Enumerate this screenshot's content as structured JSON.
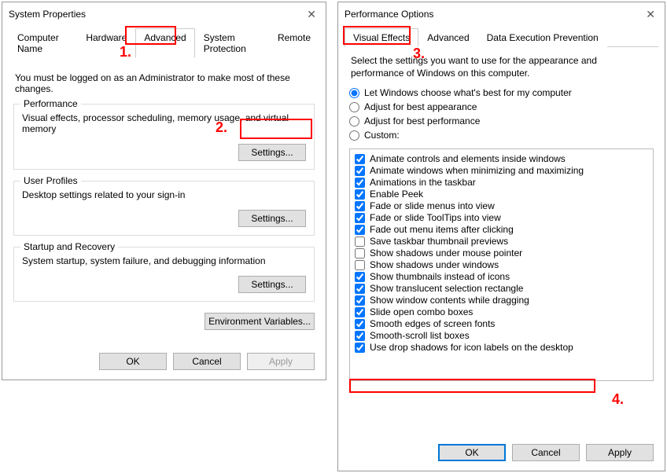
{
  "left": {
    "title": "System Properties",
    "tabs": [
      "Computer Name",
      "Hardware",
      "Advanced",
      "System Protection",
      "Remote"
    ],
    "intro": "You must be logged on as an Administrator to make most of these changes.",
    "groups": {
      "performance": {
        "legend": "Performance",
        "desc": "Visual effects, processor scheduling, memory usage, and virtual memory",
        "btn": "Settings..."
      },
      "userProfiles": {
        "legend": "User Profiles",
        "desc": "Desktop settings related to your sign-in",
        "btn": "Settings..."
      },
      "startup": {
        "legend": "Startup and Recovery",
        "desc": "System startup, system failure, and debugging information",
        "btn": "Settings..."
      }
    },
    "envBtn": "Environment Variables...",
    "buttons": {
      "ok": "OK",
      "cancel": "Cancel",
      "apply": "Apply"
    }
  },
  "right": {
    "title": "Performance Options",
    "tabs": [
      "Visual Effects",
      "Advanced",
      "Data Execution Prevention"
    ],
    "desc": "Select the settings you want to use for the appearance and performance of Windows on this computer.",
    "radios": [
      {
        "label": "Let Windows choose what's best for my computer",
        "checked": true
      },
      {
        "label": "Adjust for best appearance",
        "checked": false
      },
      {
        "label": "Adjust for best performance",
        "checked": false
      },
      {
        "label": "Custom:",
        "checked": false
      }
    ],
    "checks": [
      {
        "label": "Animate controls and elements inside windows",
        "checked": true
      },
      {
        "label": "Animate windows when minimizing and maximizing",
        "checked": true
      },
      {
        "label": "Animations in the taskbar",
        "checked": true
      },
      {
        "label": "Enable Peek",
        "checked": true
      },
      {
        "label": "Fade or slide menus into view",
        "checked": true
      },
      {
        "label": "Fade or slide ToolTips into view",
        "checked": true
      },
      {
        "label": "Fade out menu items after clicking",
        "checked": true
      },
      {
        "label": "Save taskbar thumbnail previews",
        "checked": false
      },
      {
        "label": "Show shadows under mouse pointer",
        "checked": false
      },
      {
        "label": "Show shadows under windows",
        "checked": false
      },
      {
        "label": "Show thumbnails instead of icons",
        "checked": true
      },
      {
        "label": "Show translucent selection rectangle",
        "checked": true
      },
      {
        "label": "Show window contents while dragging",
        "checked": true
      },
      {
        "label": "Slide open combo boxes",
        "checked": true
      },
      {
        "label": "Smooth edges of screen fonts",
        "checked": true
      },
      {
        "label": "Smooth-scroll list boxes",
        "checked": true
      },
      {
        "label": "Use drop shadows for icon labels on the desktop",
        "checked": true
      }
    ],
    "buttons": {
      "ok": "OK",
      "cancel": "Cancel",
      "apply": "Apply"
    }
  },
  "annotations": {
    "a1": "1.",
    "a2": "2.",
    "a3": "3.",
    "a4": "4."
  }
}
